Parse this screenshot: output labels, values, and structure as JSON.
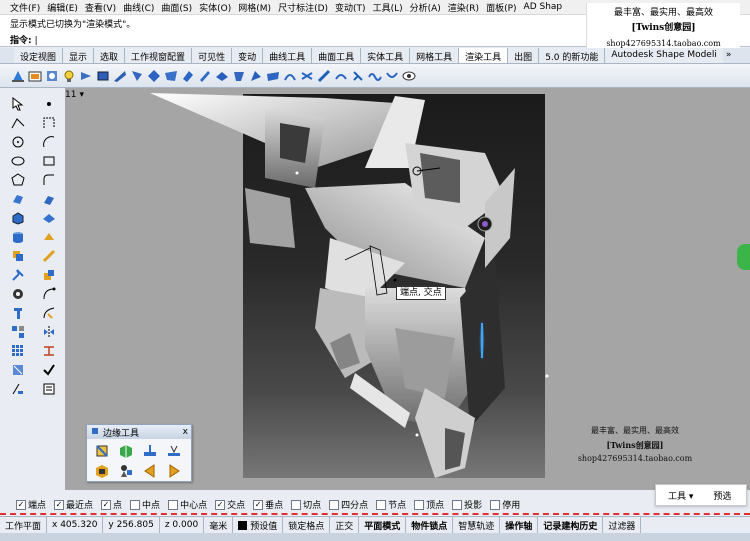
{
  "menu": [
    "文件(F)",
    "编辑(E)",
    "查看(V)",
    "曲线(C)",
    "曲面(S)",
    "实体(O)",
    "网格(M)",
    "尺寸标注(D)",
    "变动(T)",
    "工具(L)",
    "分析(A)",
    "渲染(R)",
    "面板(P)",
    "AD Shap"
  ],
  "command": {
    "history": "显示模式已切换为\"渲染模式\"。",
    "prompt_label": "指令:",
    "cursor": "|"
  },
  "tabs": [
    "设定视图",
    "显示",
    "选取",
    "工作视窗配置",
    "可见性",
    "变动",
    "曲线工具",
    "曲面工具",
    "实体工具",
    "网格工具",
    "渲染工具",
    "出图",
    "5.0 的新功能",
    "Autodesk Shape Modeli"
  ],
  "tabs_more": "»",
  "ad": {
    "line1": "最丰富、最实用、最高效",
    "line2": "[Twins创意园]",
    "line3": "shop427695314.taobao.com"
  },
  "viewport": {
    "label": "11",
    "menu_arrow": "▾"
  },
  "snap_tooltip": "端点, 交点",
  "watermark": {
    "line1": "最丰富、最实用、最高效",
    "line2": "[Twins创意园]",
    "line3": "shop427695314.taobao.com"
  },
  "float_panel": {
    "title": "边缘工具",
    "close": "x"
  },
  "osnaps": [
    {
      "label": "端点",
      "checked": true
    },
    {
      "label": "最近点",
      "checked": true
    },
    {
      "label": "点",
      "checked": true
    },
    {
      "label": "中点",
      "checked": false
    },
    {
      "label": "中心点",
      "checked": false
    },
    {
      "label": "交点",
      "checked": true
    },
    {
      "label": "垂点",
      "checked": true
    },
    {
      "label": "切点",
      "checked": false
    },
    {
      "label": "四分点",
      "checked": false
    },
    {
      "label": "节点",
      "checked": false
    },
    {
      "label": "顶点",
      "checked": false
    },
    {
      "label": "投影",
      "checked": false
    },
    {
      "label": "停用",
      "checked": false
    }
  ],
  "status": {
    "cplane": "工作平面",
    "x": "x 405.320",
    "y": "y 256.805",
    "z": "z 0.000",
    "units": "毫米",
    "layer": "预设值",
    "grid_snap": "锁定格点",
    "ortho": "正交",
    "planar": "平面模式",
    "osnap": "物件锁点",
    "smarttrack": "智慧轨迹",
    "gumball": "操作轴",
    "history": "记录建构历史",
    "filter": "过滤器"
  },
  "popup": {
    "tools": "工具",
    "tools_arrow": "▾",
    "preview": "预选"
  },
  "colors": {
    "viewport_bg": "#a5a5a5",
    "redline": "#e03030",
    "glow": "#3aa8ff"
  }
}
